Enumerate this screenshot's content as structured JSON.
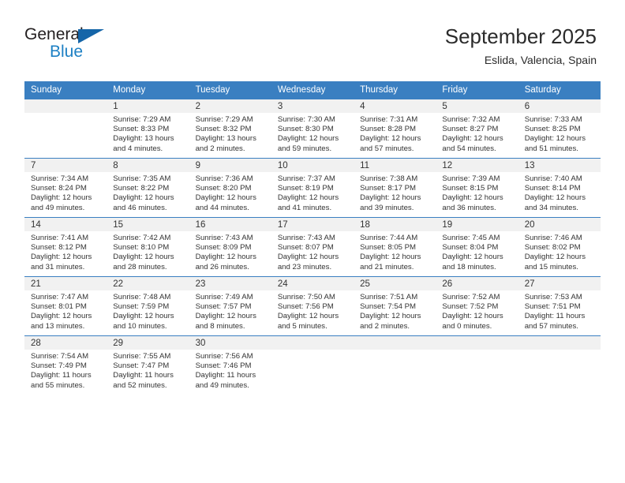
{
  "logo": {
    "word_one": "General",
    "word_two": "Blue",
    "triangle_color": "#1565a8",
    "blue_color": "#1d80c4"
  },
  "header": {
    "title": "September 2025",
    "subtitle": "Eslida, Valencia, Spain"
  },
  "theme": {
    "header_blue": "#3a7fc1",
    "row_band_gray": "#f1f1f1",
    "text_color": "#333333"
  },
  "calendar": {
    "weekday_headers": [
      "Sunday",
      "Monday",
      "Tuesday",
      "Wednesday",
      "Thursday",
      "Friday",
      "Saturday"
    ],
    "labels": {
      "sunrise": "Sunrise:",
      "sunset": "Sunset:",
      "daylight": "Daylight:"
    },
    "weeks": [
      [
        {
          "day": "",
          "empty": true
        },
        {
          "day": "1",
          "line1": "Sunrise: 7:29 AM",
          "line2": "Sunset: 8:33 PM",
          "line3": "Daylight: 13 hours",
          "line4": "and 4 minutes."
        },
        {
          "day": "2",
          "line1": "Sunrise: 7:29 AM",
          "line2": "Sunset: 8:32 PM",
          "line3": "Daylight: 13 hours",
          "line4": "and 2 minutes."
        },
        {
          "day": "3",
          "line1": "Sunrise: 7:30 AM",
          "line2": "Sunset: 8:30 PM",
          "line3": "Daylight: 12 hours",
          "line4": "and 59 minutes."
        },
        {
          "day": "4",
          "line1": "Sunrise: 7:31 AM",
          "line2": "Sunset: 8:28 PM",
          "line3": "Daylight: 12 hours",
          "line4": "and 57 minutes."
        },
        {
          "day": "5",
          "line1": "Sunrise: 7:32 AM",
          "line2": "Sunset: 8:27 PM",
          "line3": "Daylight: 12 hours",
          "line4": "and 54 minutes."
        },
        {
          "day": "6",
          "line1": "Sunrise: 7:33 AM",
          "line2": "Sunset: 8:25 PM",
          "line3": "Daylight: 12 hours",
          "line4": "and 51 minutes."
        }
      ],
      [
        {
          "day": "7",
          "line1": "Sunrise: 7:34 AM",
          "line2": "Sunset: 8:24 PM",
          "line3": "Daylight: 12 hours",
          "line4": "and 49 minutes."
        },
        {
          "day": "8",
          "line1": "Sunrise: 7:35 AM",
          "line2": "Sunset: 8:22 PM",
          "line3": "Daylight: 12 hours",
          "line4": "and 46 minutes."
        },
        {
          "day": "9",
          "line1": "Sunrise: 7:36 AM",
          "line2": "Sunset: 8:20 PM",
          "line3": "Daylight: 12 hours",
          "line4": "and 44 minutes."
        },
        {
          "day": "10",
          "line1": "Sunrise: 7:37 AM",
          "line2": "Sunset: 8:19 PM",
          "line3": "Daylight: 12 hours",
          "line4": "and 41 minutes."
        },
        {
          "day": "11",
          "line1": "Sunrise: 7:38 AM",
          "line2": "Sunset: 8:17 PM",
          "line3": "Daylight: 12 hours",
          "line4": "and 39 minutes."
        },
        {
          "day": "12",
          "line1": "Sunrise: 7:39 AM",
          "line2": "Sunset: 8:15 PM",
          "line3": "Daylight: 12 hours",
          "line4": "and 36 minutes."
        },
        {
          "day": "13",
          "line1": "Sunrise: 7:40 AM",
          "line2": "Sunset: 8:14 PM",
          "line3": "Daylight: 12 hours",
          "line4": "and 34 minutes."
        }
      ],
      [
        {
          "day": "14",
          "line1": "Sunrise: 7:41 AM",
          "line2": "Sunset: 8:12 PM",
          "line3": "Daylight: 12 hours",
          "line4": "and 31 minutes."
        },
        {
          "day": "15",
          "line1": "Sunrise: 7:42 AM",
          "line2": "Sunset: 8:10 PM",
          "line3": "Daylight: 12 hours",
          "line4": "and 28 minutes."
        },
        {
          "day": "16",
          "line1": "Sunrise: 7:43 AM",
          "line2": "Sunset: 8:09 PM",
          "line3": "Daylight: 12 hours",
          "line4": "and 26 minutes."
        },
        {
          "day": "17",
          "line1": "Sunrise: 7:43 AM",
          "line2": "Sunset: 8:07 PM",
          "line3": "Daylight: 12 hours",
          "line4": "and 23 minutes."
        },
        {
          "day": "18",
          "line1": "Sunrise: 7:44 AM",
          "line2": "Sunset: 8:05 PM",
          "line3": "Daylight: 12 hours",
          "line4": "and 21 minutes."
        },
        {
          "day": "19",
          "line1": "Sunrise: 7:45 AM",
          "line2": "Sunset: 8:04 PM",
          "line3": "Daylight: 12 hours",
          "line4": "and 18 minutes."
        },
        {
          "day": "20",
          "line1": "Sunrise: 7:46 AM",
          "line2": "Sunset: 8:02 PM",
          "line3": "Daylight: 12 hours",
          "line4": "and 15 minutes."
        }
      ],
      [
        {
          "day": "21",
          "line1": "Sunrise: 7:47 AM",
          "line2": "Sunset: 8:01 PM",
          "line3": "Daylight: 12 hours",
          "line4": "and 13 minutes."
        },
        {
          "day": "22",
          "line1": "Sunrise: 7:48 AM",
          "line2": "Sunset: 7:59 PM",
          "line3": "Daylight: 12 hours",
          "line4": "and 10 minutes."
        },
        {
          "day": "23",
          "line1": "Sunrise: 7:49 AM",
          "line2": "Sunset: 7:57 PM",
          "line3": "Daylight: 12 hours",
          "line4": "and 8 minutes."
        },
        {
          "day": "24",
          "line1": "Sunrise: 7:50 AM",
          "line2": "Sunset: 7:56 PM",
          "line3": "Daylight: 12 hours",
          "line4": "and 5 minutes."
        },
        {
          "day": "25",
          "line1": "Sunrise: 7:51 AM",
          "line2": "Sunset: 7:54 PM",
          "line3": "Daylight: 12 hours",
          "line4": "and 2 minutes."
        },
        {
          "day": "26",
          "line1": "Sunrise: 7:52 AM",
          "line2": "Sunset: 7:52 PM",
          "line3": "Daylight: 12 hours",
          "line4": "and 0 minutes."
        },
        {
          "day": "27",
          "line1": "Sunrise: 7:53 AM",
          "line2": "Sunset: 7:51 PM",
          "line3": "Daylight: 11 hours",
          "line4": "and 57 minutes."
        }
      ],
      [
        {
          "day": "28",
          "line1": "Sunrise: 7:54 AM",
          "line2": "Sunset: 7:49 PM",
          "line3": "Daylight: 11 hours",
          "line4": "and 55 minutes."
        },
        {
          "day": "29",
          "line1": "Sunrise: 7:55 AM",
          "line2": "Sunset: 7:47 PM",
          "line3": "Daylight: 11 hours",
          "line4": "and 52 minutes."
        },
        {
          "day": "30",
          "line1": "Sunrise: 7:56 AM",
          "line2": "Sunset: 7:46 PM",
          "line3": "Daylight: 11 hours",
          "line4": "and 49 minutes."
        },
        {
          "day": "",
          "empty": true
        },
        {
          "day": "",
          "empty": true
        },
        {
          "day": "",
          "empty": true
        },
        {
          "day": "",
          "empty": true
        }
      ]
    ]
  }
}
